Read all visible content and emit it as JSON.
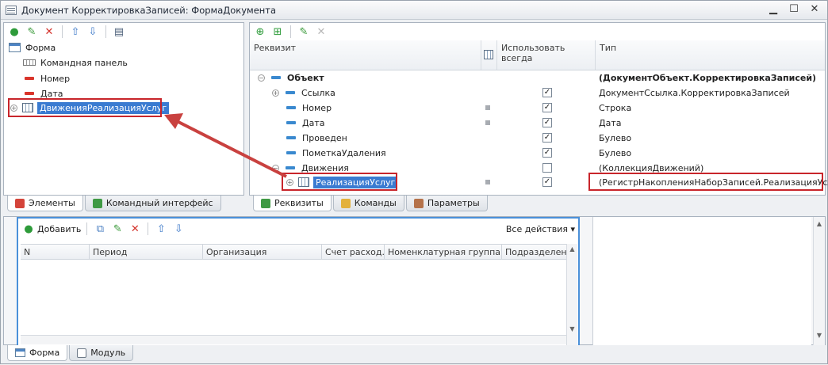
{
  "window": {
    "title": "Документ КорректировкаЗаписей: ФормаДокумента"
  },
  "icons": {
    "add": "add-icon",
    "edit": "pencil-icon",
    "delete": "delete-icon",
    "up": "arrow-up-icon",
    "down": "arrow-down-icon"
  },
  "left_tree": {
    "items": [
      {
        "label": "Форма"
      },
      {
        "label": "Командная панель"
      },
      {
        "label": "Номер"
      },
      {
        "label": "Дата"
      },
      {
        "label": "ДвиженияРеализацияУслуг"
      }
    ]
  },
  "left_tabs": [
    {
      "label": "Элементы"
    },
    {
      "label": "Командный интерфейс"
    }
  ],
  "right_grid": {
    "headers": {
      "rekvizit": "Реквизит",
      "use_always_1": "Использовать",
      "use_always_2": "всегда",
      "type": "Тип"
    },
    "rows": [
      {
        "name": "Объект",
        "type": "(ДокументОбъект.КорректировкаЗаписей)"
      },
      {
        "name": "Ссылка",
        "type": "ДокументСсылка.КорректировкаЗаписей"
      },
      {
        "name": "Номер",
        "type": "Строка"
      },
      {
        "name": "Дата",
        "type": "Дата"
      },
      {
        "name": "Проведен",
        "type": "Булево"
      },
      {
        "name": "ПометкаУдаления",
        "type": "Булево"
      },
      {
        "name": "Движения",
        "type": "(КоллекцияДвижений)"
      },
      {
        "name": "РеализацияУслуг",
        "type": "(РегистрНакопленияНаборЗаписей.РеализацияУслуг)"
      }
    ],
    "checkmark": "✓"
  },
  "right_tabs": [
    {
      "label": "Реквизиты"
    },
    {
      "label": "Команды"
    },
    {
      "label": "Параметры"
    }
  ],
  "bottom": {
    "add_label": "Добавить",
    "all_actions": "Все действия ▾",
    "columns": [
      "N",
      "Период",
      "Организация",
      "Счет расход...",
      "Номенклатурная группа",
      "Подразделени"
    ]
  },
  "bottom_tabs": [
    {
      "label": "Форма"
    },
    {
      "label": "Модуль"
    }
  ],
  "colors": {
    "accent": "#3a7bd1",
    "highlight_border": "#c8252b",
    "arrow": "#c9413f"
  }
}
